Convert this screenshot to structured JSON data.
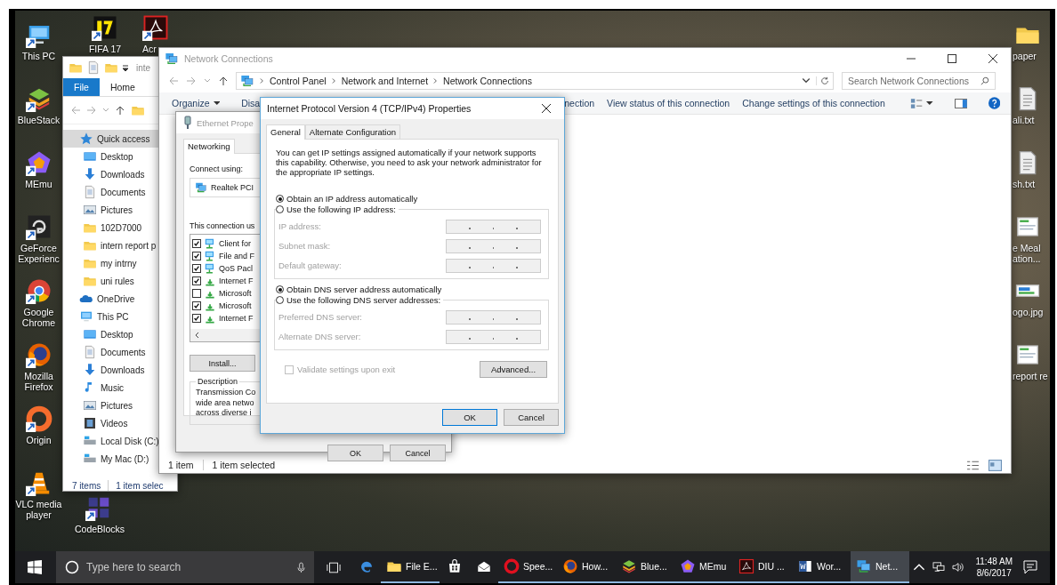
{
  "desktop_left": [
    {
      "label": "This PC",
      "kind": "pc"
    },
    {
      "label": "BlueStack",
      "kind": "bluestacks"
    },
    {
      "label": "MEmu",
      "kind": "memu"
    },
    {
      "label": "GeForce Experienc",
      "kind": "geforce"
    },
    {
      "label": "Google Chrome",
      "kind": "chrome"
    },
    {
      "label": "Mozilla Firefox",
      "kind": "firefox"
    },
    {
      "label": "Origin",
      "kind": "origin"
    },
    {
      "label": "VLC media player",
      "kind": "vlc"
    }
  ],
  "desktop_top": [
    {
      "label": "FIFA 17",
      "kind": "game"
    },
    {
      "label": "Acr",
      "kind": "pdf"
    }
  ],
  "desktop_bottom": [
    {
      "label": "CodeBlocks",
      "kind": "codeblocks"
    }
  ],
  "desktop_right": [
    {
      "label": "paper",
      "kind": "folder"
    },
    {
      "label": "ali.txt",
      "kind": "text"
    },
    {
      "label": "sh.txt",
      "kind": "text"
    },
    {
      "label": "e Meal ation...",
      "kind": "doc"
    },
    {
      "label": "ogo.jpg",
      "kind": "image"
    },
    {
      "label": "report re",
      "kind": "doc"
    }
  ],
  "explorer": {
    "title": "inte",
    "ribbon_tabs": [
      {
        "label": "File",
        "selected": true
      },
      {
        "label": "Home",
        "selected": false
      }
    ],
    "tree": [
      {
        "label": "Quick access",
        "kind": "star",
        "selected": true,
        "children": [
          {
            "label": "Desktop",
            "kind": "desktop",
            "selected": false
          },
          {
            "label": "Downloads",
            "kind": "download",
            "selected": false
          },
          {
            "label": "Documents",
            "kind": "document",
            "selected": false
          },
          {
            "label": "Pictures",
            "kind": "pictures",
            "selected": false
          },
          {
            "label": "102D7000",
            "kind": "folder",
            "selected": false
          },
          {
            "label": "intern report p",
            "kind": "folder",
            "selected": false
          },
          {
            "label": "my intrny",
            "kind": "folder",
            "selected": false
          },
          {
            "label": "uni rules",
            "kind": "folder",
            "selected": false
          }
        ]
      },
      {
        "label": "OneDrive",
        "kind": "cloud",
        "selected": false
      },
      {
        "label": "This PC",
        "kind": "pc",
        "selected": false,
        "children": [
          {
            "label": "Desktop",
            "kind": "desktop",
            "selected": false
          },
          {
            "label": "Documents",
            "kind": "document",
            "selected": false
          },
          {
            "label": "Downloads",
            "kind": "download",
            "selected": false
          },
          {
            "label": "Music",
            "kind": "music",
            "selected": false
          },
          {
            "label": "Pictures",
            "kind": "pictures",
            "selected": false
          },
          {
            "label": "Videos",
            "kind": "videos",
            "selected": false
          },
          {
            "label": "Local Disk (C:)",
            "kind": "disk",
            "selected": false
          },
          {
            "label": "My Mac (D:)",
            "kind": "disk",
            "selected": false
          }
        ]
      }
    ],
    "status": [
      "7 items",
      "1 item selec"
    ]
  },
  "network_window": {
    "title": "Network Connections",
    "breadcrumb": [
      "Control Panel",
      "Network and Internet",
      "Network Connections"
    ],
    "search": {
      "placeholder": "Search Network Connections"
    },
    "toolbar": [
      "Organize",
      "Disa",
      "nection",
      "View status of this connection",
      "Change settings of this connection"
    ],
    "status": [
      "1 item",
      "1 item selected"
    ]
  },
  "ethernet_dialog": {
    "title": "Ethernet Prope",
    "tab": "Networking",
    "connect_label": "Connect using:",
    "adapter": "Realtek PCI",
    "uses_label": "This connection us",
    "components": [
      {
        "label": "Client for",
        "kind": "service",
        "checked": true
      },
      {
        "label": "File and F",
        "kind": "service",
        "checked": true
      },
      {
        "label": "QoS Pacl",
        "kind": "service",
        "checked": true
      },
      {
        "label": "Internet F",
        "kind": "protocol",
        "checked": true
      },
      {
        "label": "Microsoft",
        "kind": "protocol",
        "checked": false
      },
      {
        "label": "Microsoft",
        "kind": "protocol",
        "checked": true
      },
      {
        "label": "Internet F",
        "kind": "protocol",
        "checked": true
      }
    ],
    "install_button": "Install...",
    "description_legend": "Description",
    "description_lines": [
      "Transmission Co",
      "wide area netwo",
      "across diverse i"
    ],
    "buttons": [
      "OK",
      "Cancel"
    ]
  },
  "ipv4_dialog": {
    "title": "Internet Protocol Version 4 (TCP/IPv4) Properties",
    "tabs": [
      {
        "label": "General",
        "selected": true
      },
      {
        "label": "Alternate Configuration",
        "selected": false
      }
    ],
    "intro": "You can get IP settings assigned automatically if your network supports this capability. Otherwise, you need to ask your network administrator for the appropriate IP settings.",
    "ip_auto": {
      "label": "Obtain an IP address automatically",
      "selected": true
    },
    "ip_manual": {
      "label": "Use the following IP address:",
      "selected": false
    },
    "ip_fields": [
      {
        "label": "IP address:",
        "disabled": true
      },
      {
        "label": "Subnet mask:",
        "disabled": true
      },
      {
        "label": "Default gateway:",
        "disabled": true
      }
    ],
    "dns_auto": {
      "label": "Obtain DNS server address automatically",
      "selected": true
    },
    "dns_manual": {
      "label": "Use the following DNS server addresses:",
      "selected": false
    },
    "dns_fields": [
      {
        "label": "Preferred DNS server:",
        "disabled": true
      },
      {
        "label": "Alternate DNS server:",
        "disabled": true
      }
    ],
    "validate": {
      "label": "Validate settings upon exit",
      "checked": false,
      "disabled": true
    },
    "advanced_button": "Advanced...",
    "buttons": [
      "OK",
      "Cancel"
    ]
  },
  "taskbar": {
    "search": {
      "placeholder": "Type here to search"
    },
    "apps": [
      {
        "kind": "edge",
        "running": false,
        "selected": false
      },
      {
        "label": "File E...",
        "kind": "folder",
        "running": true,
        "selected": false
      },
      {
        "kind": "store",
        "running": false,
        "selected": false
      },
      {
        "kind": "mail",
        "running": false,
        "selected": false
      },
      {
        "label": "Spee...",
        "kind": "opera",
        "running": true,
        "selected": false
      },
      {
        "label": "How...",
        "kind": "firefox",
        "running": true,
        "selected": false
      },
      {
        "label": "Blue...",
        "kind": "bluestacks",
        "running": true,
        "selected": false
      },
      {
        "label": "MEmu",
        "kind": "memu",
        "running": true,
        "selected": false
      },
      {
        "label": "DIU ...",
        "kind": "pdf",
        "running": true,
        "selected": false
      },
      {
        "label": "Wor...",
        "kind": "word",
        "running": true,
        "selected": false
      },
      {
        "label": "Net...",
        "kind": "network",
        "running": true,
        "selected": true
      }
    ],
    "time": "11:48 AM",
    "date": "8/6/2017"
  }
}
